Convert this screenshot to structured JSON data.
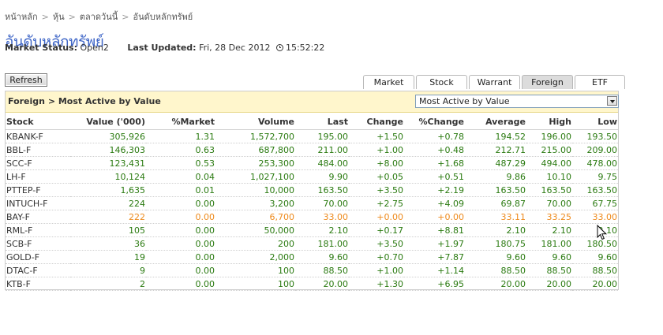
{
  "breadcrumb": {
    "items": [
      "หน้าหลัก",
      "หุ้น",
      "ตลาดวันนี้",
      "อันดับหลักทรัพย์"
    ],
    "separator": ">"
  },
  "page": {
    "title": "อันดับหลักทรัพย์",
    "status_label": "Market Status:",
    "status_value": "Open2",
    "updated_label": "Last Updated:",
    "updated_value": "Fri, 28 Dec 2012",
    "updated_time": "15:52:22"
  },
  "toolbar": {
    "refresh_label": "Refresh"
  },
  "tabs": [
    {
      "label": "Market",
      "active": false
    },
    {
      "label": "Stock",
      "active": false
    },
    {
      "label": "Warrant",
      "active": false
    },
    {
      "label": "Foreign",
      "active": true
    },
    {
      "label": "ETF",
      "active": false
    }
  ],
  "panel": {
    "title": "Foreign > Most Active by Value",
    "select_value": "Most Active by Value"
  },
  "table": {
    "columns": [
      "Stock",
      "Value ('000)",
      "%Market",
      "Volume",
      "Last",
      "Change",
      "%Change",
      "Average",
      "High",
      "Low"
    ],
    "rows": [
      {
        "trend": "up",
        "cells": [
          "KBANK-F",
          "305,926",
          "1.31",
          "1,572,700",
          "195.00",
          "+1.50",
          "+0.78",
          "194.52",
          "196.00",
          "193.50"
        ]
      },
      {
        "trend": "up",
        "cells": [
          "BBL-F",
          "146,303",
          "0.63",
          "687,800",
          "211.00",
          "+1.00",
          "+0.48",
          "212.71",
          "215.00",
          "209.00"
        ]
      },
      {
        "trend": "up",
        "cells": [
          "SCC-F",
          "123,431",
          "0.53",
          "253,300",
          "484.00",
          "+8.00",
          "+1.68",
          "487.29",
          "494.00",
          "478.00"
        ]
      },
      {
        "trend": "up",
        "cells": [
          "LH-F",
          "10,124",
          "0.04",
          "1,027,100",
          "9.90",
          "+0.05",
          "+0.51",
          "9.86",
          "10.10",
          "9.75"
        ]
      },
      {
        "trend": "up",
        "cells": [
          "PTTEP-F",
          "1,635",
          "0.01",
          "10,000",
          "163.50",
          "+3.50",
          "+2.19",
          "163.50",
          "163.50",
          "163.50"
        ]
      },
      {
        "trend": "up",
        "cells": [
          "INTUCH-F",
          "224",
          "0.00",
          "3,200",
          "70.00",
          "+2.75",
          "+4.09",
          "69.87",
          "70.00",
          "67.75"
        ]
      },
      {
        "trend": "flat",
        "cells": [
          "BAY-F",
          "222",
          "0.00",
          "6,700",
          "33.00",
          "+0.00",
          "+0.00",
          "33.11",
          "33.25",
          "33.00"
        ]
      },
      {
        "trend": "up",
        "cells": [
          "RML-F",
          "105",
          "0.00",
          "50,000",
          "2.10",
          "+0.17",
          "+8.81",
          "2.10",
          "2.10",
          "2.10"
        ]
      },
      {
        "trend": "up",
        "cells": [
          "SCB-F",
          "36",
          "0.00",
          "200",
          "181.00",
          "+3.50",
          "+1.97",
          "180.75",
          "181.00",
          "180.50"
        ]
      },
      {
        "trend": "up",
        "cells": [
          "GOLD-F",
          "19",
          "0.00",
          "2,000",
          "9.60",
          "+0.70",
          "+7.87",
          "9.60",
          "9.60",
          "9.60"
        ]
      },
      {
        "trend": "up",
        "cells": [
          "DTAC-F",
          "9",
          "0.00",
          "100",
          "88.50",
          "+1.00",
          "+1.14",
          "88.50",
          "88.50",
          "88.50"
        ]
      },
      {
        "trend": "up",
        "cells": [
          "KTB-F",
          "2",
          "0.00",
          "100",
          "20.00",
          "+1.30",
          "+6.95",
          "20.00",
          "20.00",
          "20.00"
        ]
      }
    ]
  },
  "colors": {
    "up": "#2a7a10",
    "flat": "#ee8a1c",
    "title": "#3f66c7",
    "panel_header_bg": "#fff6cc"
  },
  "icons": {
    "clock": "clock-icon",
    "dropdown": "chevron-down-icon",
    "cursor": "mouse-pointer-icon"
  }
}
